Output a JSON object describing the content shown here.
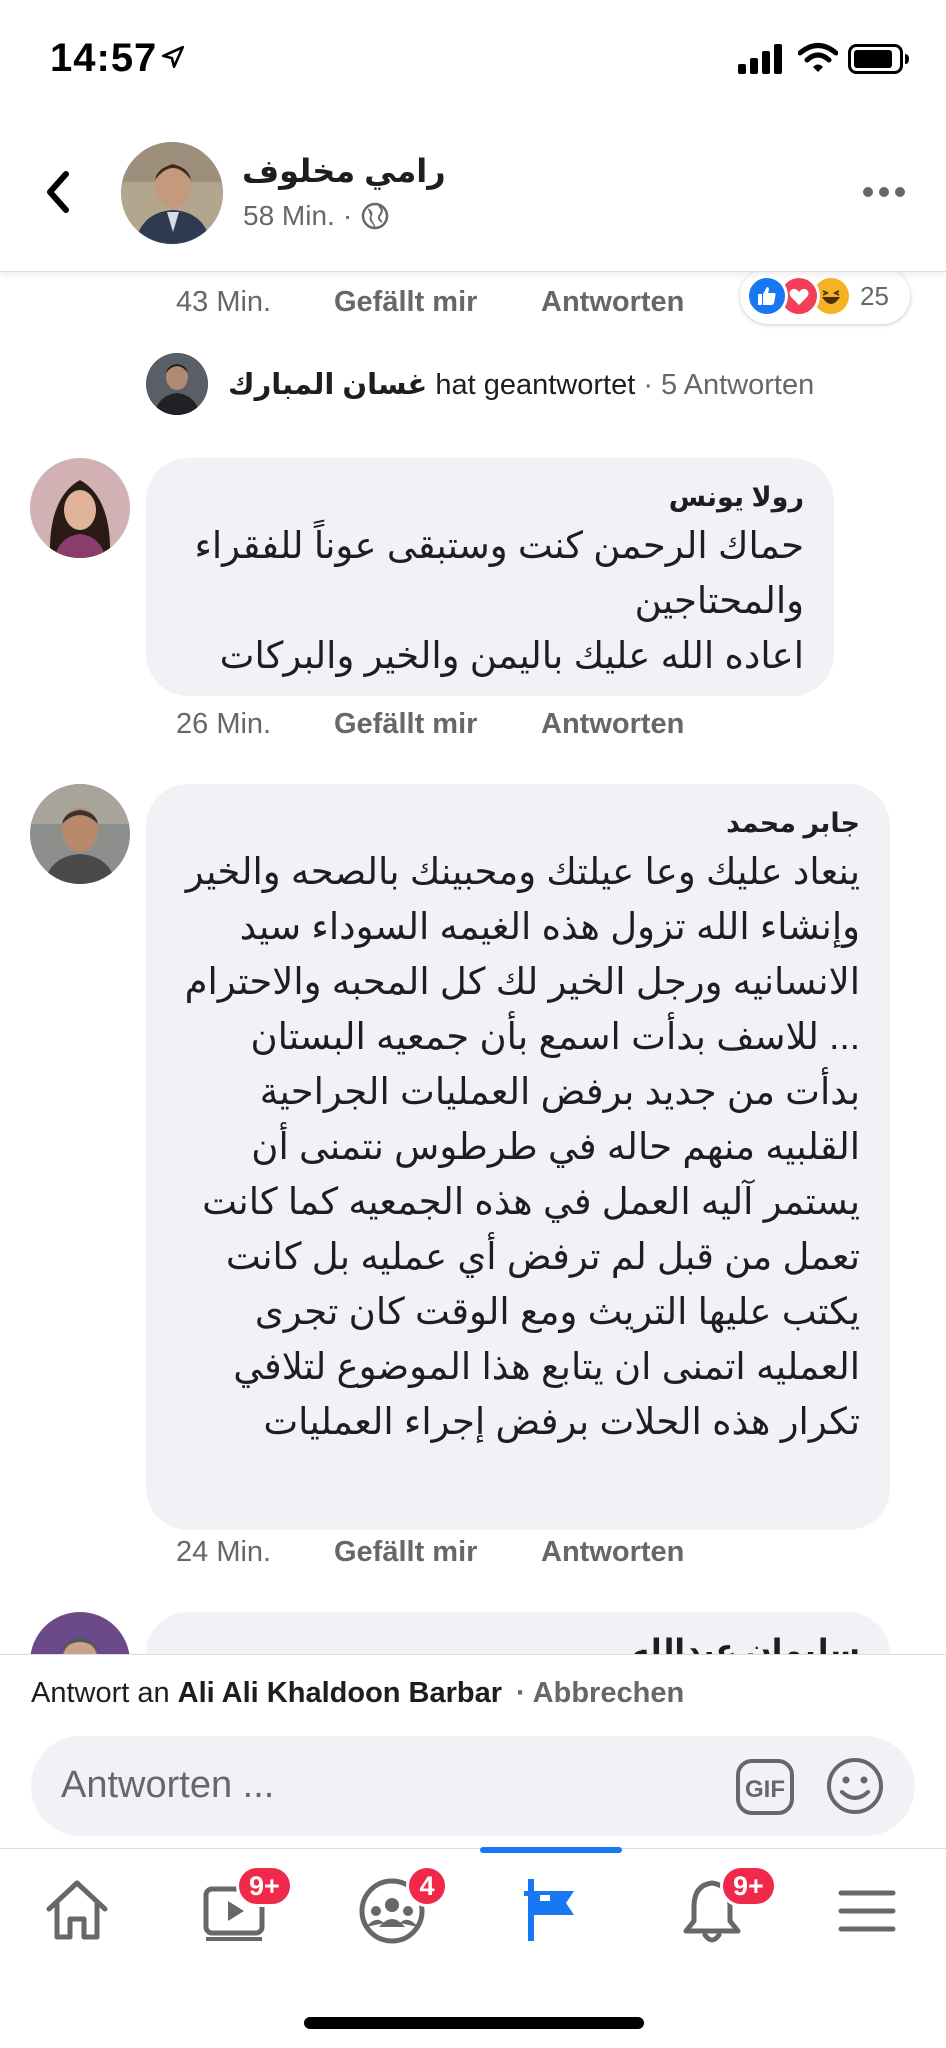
{
  "status_bar": {
    "time": "14:57"
  },
  "post_header": {
    "name": "رامي مخلوف",
    "time": "58 Min.",
    "dot": "·"
  },
  "top_actions": {
    "time": "43 Min.",
    "like": "Gefällt mir",
    "reply": "Antworten",
    "reaction_count": "25"
  },
  "replies_summary": {
    "name": "غسان المبارك",
    "text": "hat geantwortet",
    "count": "· 5 Antworten"
  },
  "comments": [
    {
      "author": "رولا يونس",
      "lines": [
        "حماك الرحمن كنت وستبقى عوناً للفقراء والمحتاجين",
        "اعاده الله عليك باليمن والخير والبركات"
      ],
      "time": "26 Min.",
      "like": "Gefällt mir",
      "reply": "Antworten"
    },
    {
      "author": "جابر محمد",
      "lines": [
        "ينعاد عليك وعا عيلتك ومحبينك بالصحه والخير وإنشاء الله تزول هذه الغيمه السوداء سيد الانسانيه ورجل الخير لك كل المحبه والاحترام ... للاسف بدأت اسمع بأن جمعيه البستان بدأت من جديد برفض العمليات الجراحية القلبيه منهم حاله في طرطوس نتمنى أن يستمر آليه العمل في هذه الجمعيه كما كانت تعمل من قبل لم ترفض أي عمليه بل كانت يكتب عليها التريث ومع الوقت كان تجرى العمليه اتمنى ان يتابع هذا الموضوع لتلافي تكرار هذه الحلات برفض إجراء العمليات"
      ],
      "time": "24 Min.",
      "like": "Gefällt mir",
      "reply": "Antworten"
    },
    {
      "author": "سليمان عبدالله"
    }
  ],
  "reply_banner": {
    "lead": "Antwort an",
    "target": "Ali Ali Khaldoon Barbar",
    "cancel": "· Abbrechen"
  },
  "composer": {
    "placeholder": "Antworten ...",
    "gif_label": "GIF"
  },
  "tabbar": {
    "tabs": [
      {
        "name": "home",
        "icon": "home-icon"
      },
      {
        "name": "watch",
        "icon": "video-icon",
        "badge": "9+"
      },
      {
        "name": "groups",
        "icon": "groups-icon",
        "badge": "4"
      },
      {
        "name": "pages",
        "icon": "flag-icon",
        "active": true
      },
      {
        "name": "notifications",
        "icon": "bell-icon",
        "badge": "9+"
      },
      {
        "name": "menu",
        "icon": "menu-icon"
      }
    ]
  },
  "colors": {
    "accent": "#1877f2",
    "badge": "#f02849",
    "bubble": "#f0f2f5",
    "secondary_text": "#65676b"
  }
}
